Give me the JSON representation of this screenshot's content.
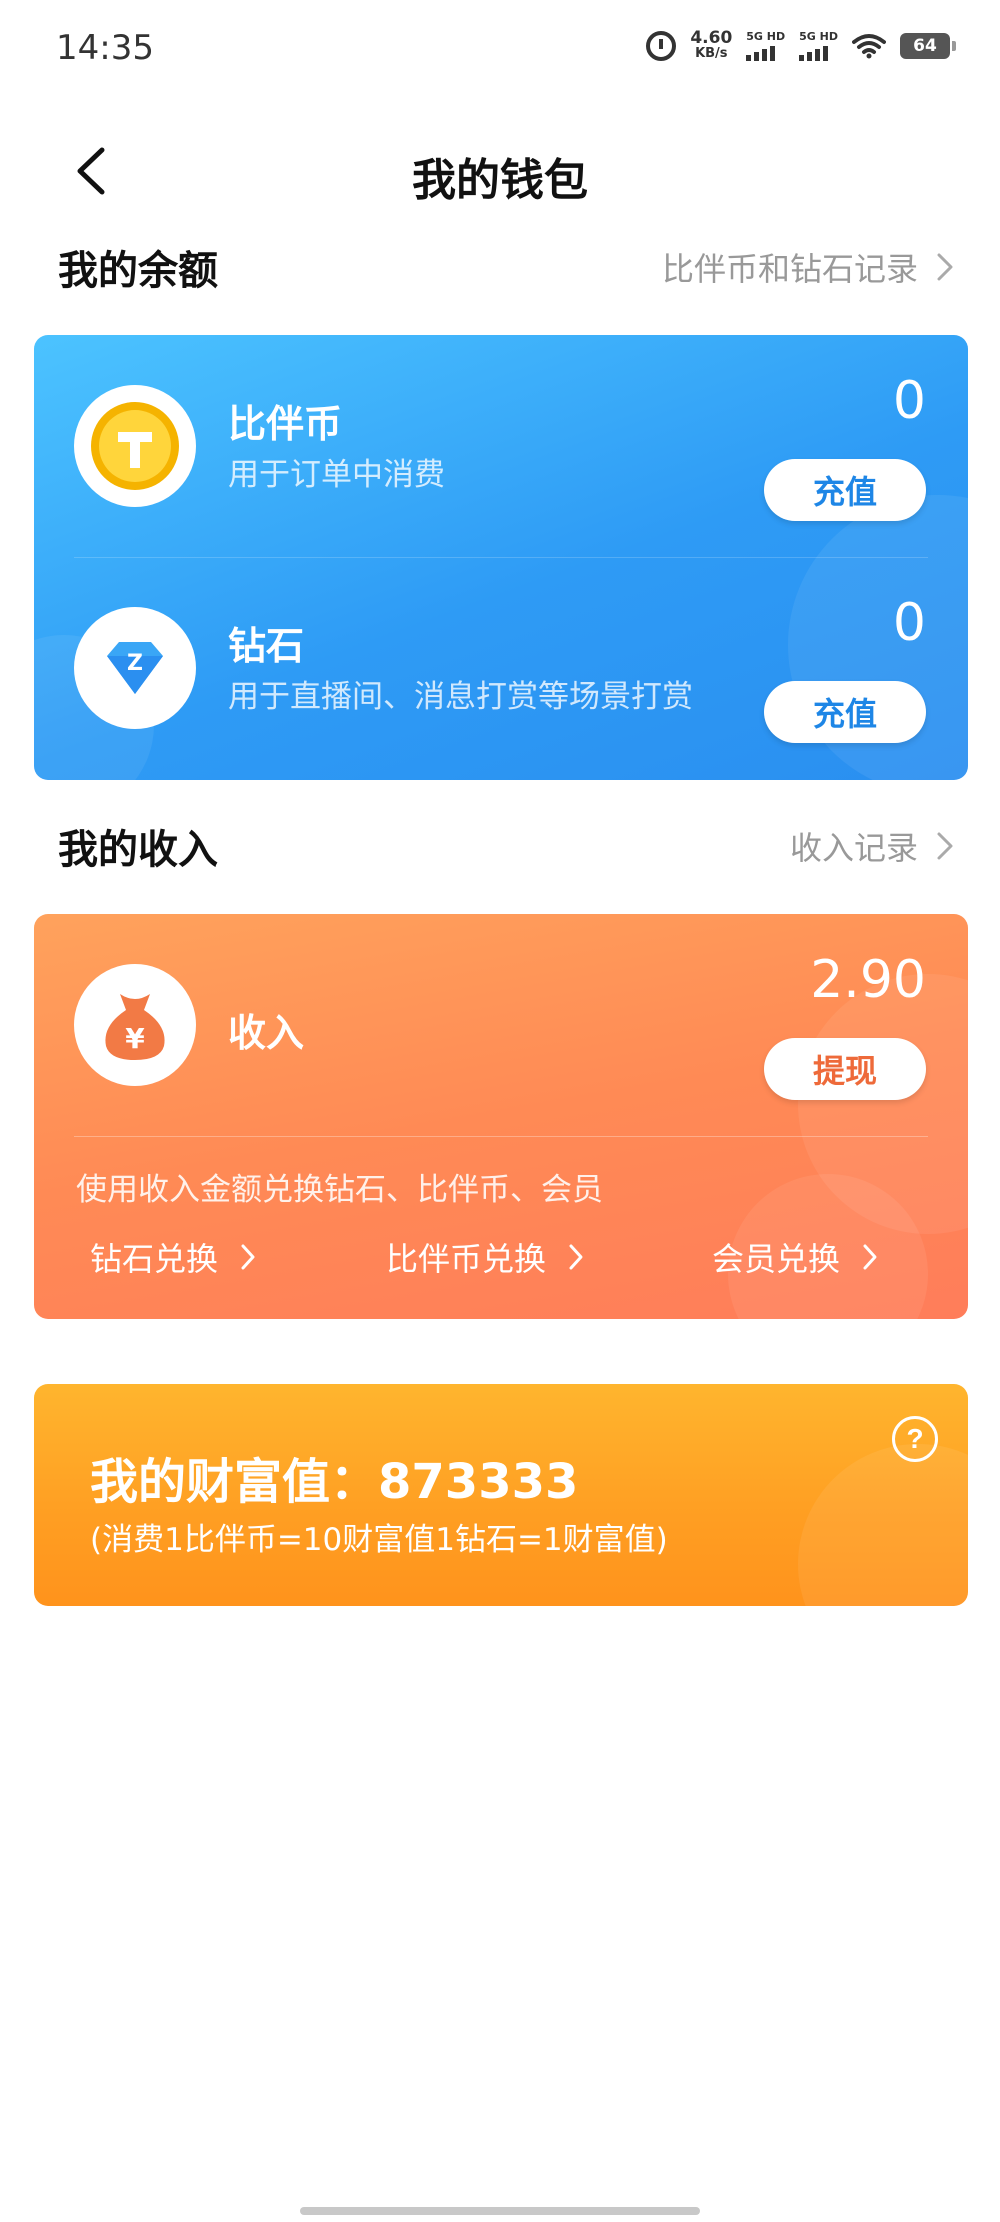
{
  "status_bar": {
    "time": "14:35",
    "net_speed_value": "4.60",
    "net_speed_unit": "KB/s",
    "sim1_label": "5G HD",
    "sim2_label": "5G HD",
    "battery_level": "64",
    "icons": [
      "alarm-icon",
      "signal-icon",
      "wifi-icon",
      "battery-icon"
    ]
  },
  "header": {
    "title": "我的钱包",
    "back_icon": "chevron-left-icon"
  },
  "balance_section": {
    "title": "我的余额",
    "link_label": "比伴币和钻石记录",
    "items": [
      {
        "name": "比伴币",
        "description": "用于订单中消费",
        "value": "0",
        "button_label": "充值",
        "icon": "coin-icon"
      },
      {
        "name": "钻石",
        "description": "用于直播间、消息打赏等场景打赏",
        "value": "0",
        "button_label": "充值",
        "icon": "diamond-icon"
      }
    ]
  },
  "income_section": {
    "title": "我的收入",
    "link_label": "收入记录",
    "label": "收入",
    "value": "2.90",
    "button_label": "提现",
    "note": "使用收入金额兑换钻石、比伴币、会员",
    "exchanges": [
      {
        "label": "钻石兑换"
      },
      {
        "label": "比伴币兑换"
      },
      {
        "label": "会员兑换"
      }
    ],
    "icon": "money-bag-icon"
  },
  "wealth": {
    "title": "我的财富值：873333",
    "subtitle": "(消费1比伴币=10财富值1钻石=1财富值)",
    "help_symbol": "?"
  },
  "colors": {
    "balance_card": "#2e9bf5",
    "income_card": "#ff8a55",
    "wealth_card": "#ff9e22",
    "blue_button_text": "#1e86e6",
    "orange_button_text": "#ee6a3a"
  }
}
